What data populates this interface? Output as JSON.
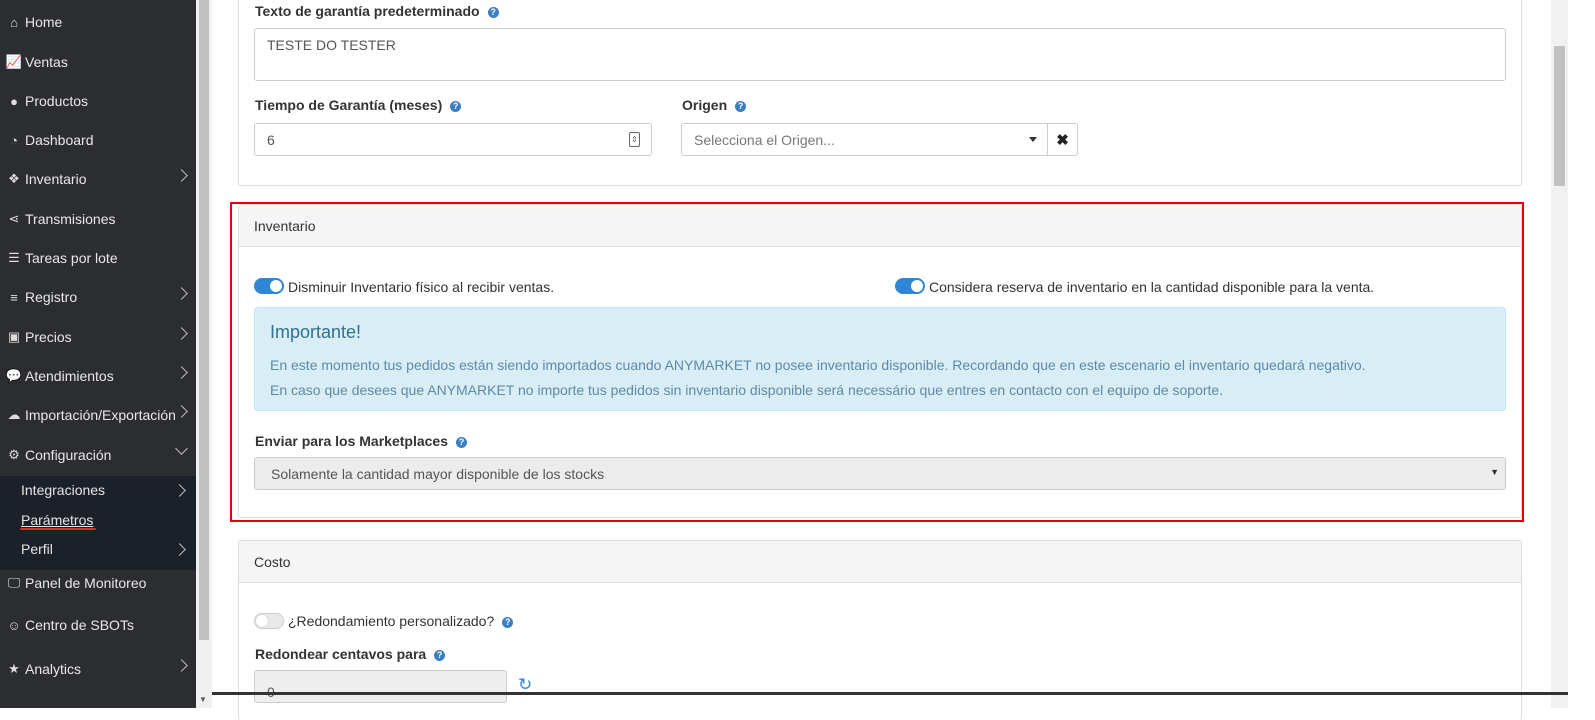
{
  "sidebar": {
    "items": [
      {
        "label": "Home",
        "icon": "home-icon",
        "glyph": "⌂",
        "chev": false
      },
      {
        "label": "Ventas",
        "icon": "chart-line-icon",
        "glyph": "📈",
        "chev": false
      },
      {
        "label": "Productos",
        "icon": "product-icon",
        "glyph": "●",
        "chev": false
      },
      {
        "label": "Dashboard",
        "icon": "dashboard-icon",
        "glyph": "◔",
        "chev": false
      },
      {
        "label": "Inventario",
        "icon": "cubes-icon",
        "glyph": "❖",
        "chev": true
      },
      {
        "label": "Transmisiones",
        "icon": "share-icon",
        "glyph": "⋖",
        "chev": false
      },
      {
        "label": "Tareas por lote",
        "icon": "tasks-icon",
        "glyph": "☰",
        "chev": false
      },
      {
        "label": "Registro",
        "icon": "list-icon",
        "glyph": "≡",
        "chev": true
      },
      {
        "label": "Precios",
        "icon": "money-icon",
        "glyph": "▣",
        "chev": true
      },
      {
        "label": "Atendimientos",
        "icon": "chat-icon",
        "glyph": "💬",
        "chev": true
      },
      {
        "label": "Importación/Exportación",
        "icon": "cloud-icon",
        "glyph": "☁",
        "chev": true
      },
      {
        "label": "Configuración",
        "icon": "gear-icon",
        "glyph": "⚙",
        "chev": true
      }
    ],
    "submenu": [
      {
        "label": "Integraciones"
      },
      {
        "label": "Parámetros"
      },
      {
        "label": "Perfil"
      }
    ],
    "bottom": [
      {
        "label": "Panel de Monitoreo",
        "icon": "monitor-icon",
        "glyph": "🖵"
      },
      {
        "label": "Centro de SBOTs",
        "icon": "robot-icon",
        "glyph": "☺"
      },
      {
        "label": "Analytics",
        "icon": "star-icon",
        "glyph": "★"
      }
    ]
  },
  "warranty": {
    "text_label": "Texto de garantía predeterminado",
    "text_value": "TESTE DO TESTER",
    "months_label": "Tiempo de Garantía (meses)",
    "months_value": "6",
    "origin_label": "Origen",
    "origin_placeholder": "Selecciona el Origen..."
  },
  "inventory": {
    "heading": "Inventario",
    "toggle1_label": "Disminuir Inventario físico al recibir ventas.",
    "toggle2_label": "Considera reserva de inventario en la cantidad disponible para la venta.",
    "alert_title": "Importante!",
    "alert_line1": "En este momento tus pedidos están siendo importados cuando ANYMARKET no posee inventario disponible. Recordando que en este escenario el inventario quedará negativo.",
    "alert_line2": "En caso que desees que ANYMARKET no importe tus pedidos sin inventario disponible será necessário que entres en contacto con el equipo de soporte.",
    "marketplaces_label": "Enviar para los Marketplaces",
    "marketplaces_value": "Solamente la cantidad mayor disponible de los stocks"
  },
  "cost": {
    "heading": "Costo",
    "rounding_label": "¿Redondamiento personalizado?",
    "cents_label": "Redondear centavos para",
    "cents_value": "0"
  },
  "colors": {
    "sidebar_bg": "#2b2d31",
    "accent": "#2f86d6",
    "highlight_border": "#e5000f"
  }
}
